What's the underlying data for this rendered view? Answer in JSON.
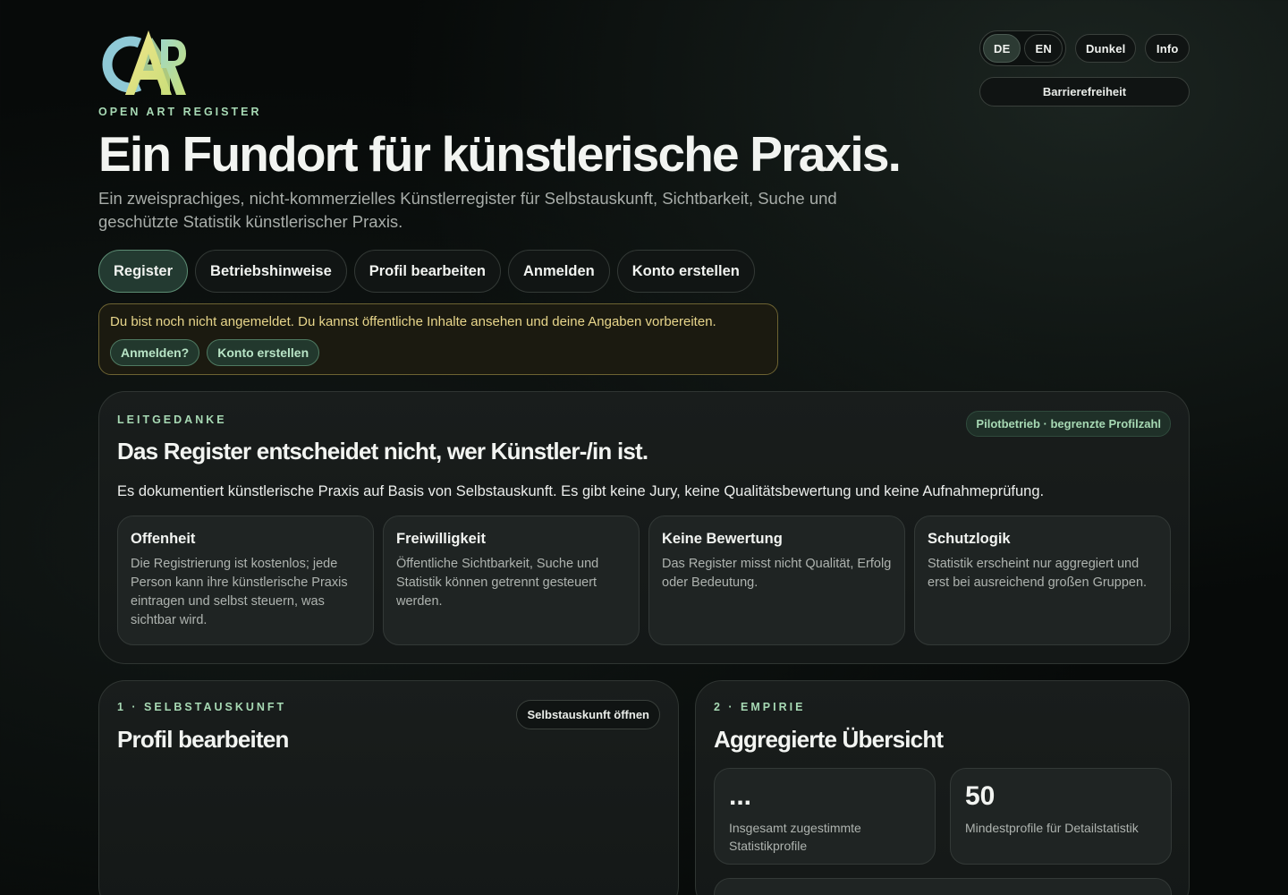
{
  "controls": {
    "lang_de": "DE",
    "lang_en": "EN",
    "theme": "Dunkel",
    "info": "Info",
    "accessibility": "Barrierefreiheit"
  },
  "header": {
    "eyebrow": "OPEN ART REGISTER",
    "title": "Ein Fundort für künstlerische Praxis.",
    "subtitle": "Ein zweisprachiges, nicht-kommerzielles Künstlerregister für Selbstauskunft, Sichtbarkeit, Suche und geschützte Statistik künstlerischer Praxis."
  },
  "nav": {
    "tabs": [
      {
        "label": "Register",
        "active": true
      },
      {
        "label": "Betriebshinweise"
      },
      {
        "label": "Profil bearbeiten"
      },
      {
        "label": "Anmelden"
      },
      {
        "label": "Konto erstellen"
      }
    ]
  },
  "notice": {
    "message": "Du bist noch nicht angemeldet. Du kannst öffentliche Inhalte ansehen und deine Angaben vorbereiten.",
    "login": "Anmelden?",
    "register": "Konto erstellen"
  },
  "leitgedanke": {
    "kicker": "LEITGEDANKE",
    "badge": "Pilotbetrieb · begrenzte Profilzahl",
    "title": "Das Register entscheidet nicht, wer Künstler-/in ist.",
    "text": "Es dokumentiert künstlerische Praxis auf Basis von Selbstauskunft. Es gibt keine Jury, keine Qualitätsbewertung und keine Aufnahmeprüfung.",
    "cards": [
      {
        "title": "Offenheit",
        "body": "Die Registrierung ist kostenlos; jede Person kann ihre künstlerische Praxis eintragen und selbst steuern, was sichtbar wird."
      },
      {
        "title": "Freiwilligkeit",
        "body": "Öffentliche Sichtbarkeit, Suche und Statistik können getrennt gesteuert werden."
      },
      {
        "title": "Keine Bewertung",
        "body": "Das Register misst nicht Qualität, Erfolg oder Bedeutung."
      },
      {
        "title": "Schutzlogik",
        "body": "Statistik erscheint nur aggregiert und erst bei ausreichend großen Gruppen."
      }
    ]
  },
  "selbstauskunft": {
    "kicker": "1 · SELBSTAUSKUNFT",
    "title": "Profil bearbeiten",
    "open_button": "Selbstauskunft öffnen"
  },
  "empirie": {
    "kicker": "2 · EMPIRIE",
    "title": "Aggregierte Übersicht",
    "stats": [
      {
        "value": "...",
        "label": "Insgesamt zugestimmte Statistikprofile"
      },
      {
        "value": "50",
        "label": "Mindestprofile für Detailstatistik"
      }
    ]
  }
}
